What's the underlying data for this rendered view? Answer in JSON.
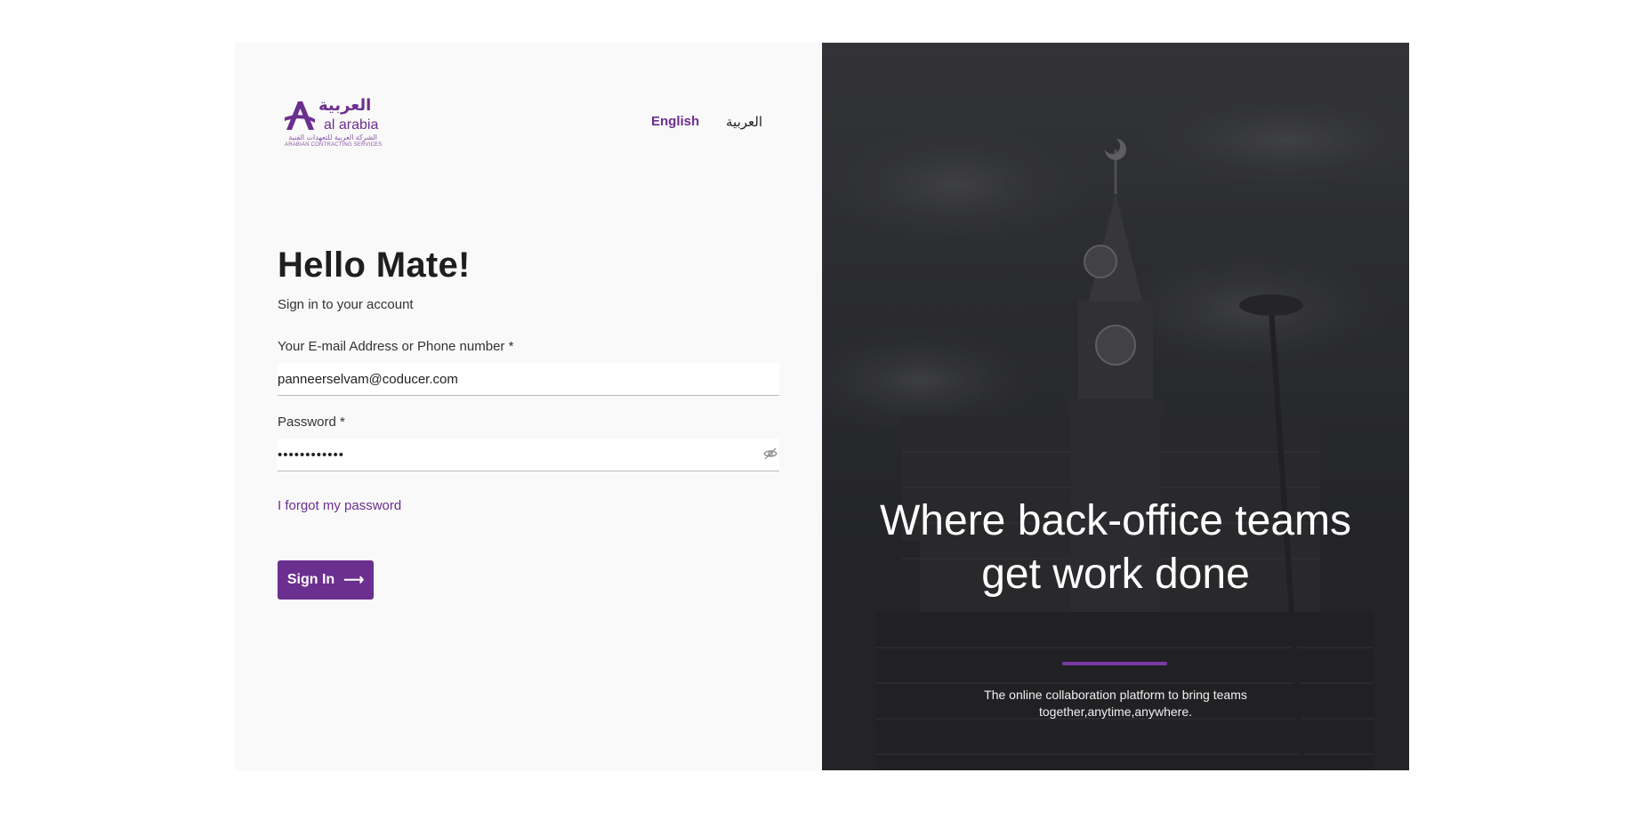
{
  "brand": {
    "name_ar": "العربية",
    "name_en": "al arabia",
    "subtitle_ar": "الشركة العربية للتعهدات الفنية",
    "subtitle_en": "ARABIAN CONTRACTING SERVICES",
    "color": "#6b2f8f"
  },
  "language": {
    "english": "English",
    "arabic": "العربية",
    "selected": "English"
  },
  "form": {
    "greeting": "Hello Mate!",
    "subtitle": "Sign in to your account",
    "email_label": "Your E-mail Address or Phone number *",
    "email_value": "panneerselvam@coducer.com",
    "password_label": "Password *",
    "password_value": "••••••••••••",
    "forgot_link": "I forgot my password",
    "submit_label": "Sign In"
  },
  "hero": {
    "headline": "Where back-office teams get work done",
    "tagline": "The online collaboration platform to bring teams together,anytime,anywhere.",
    "accent_color": "#7a3aa3"
  },
  "icons": {
    "password_toggle": "eye-off-icon",
    "submit_arrow": "arrow-right-icon",
    "logo_mark": "letter-a-logo-icon"
  }
}
